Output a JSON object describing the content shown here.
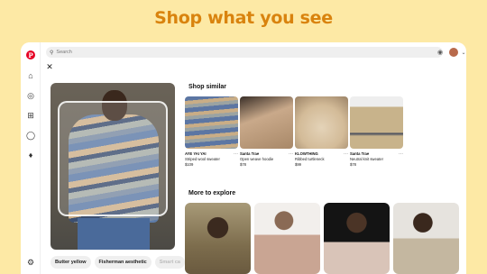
{
  "headline": "Shop what you see",
  "search": {
    "placeholder": "Search"
  },
  "main_chips": [
    "Butter yellow",
    "Fisherman aesthetic",
    "Smart ca"
  ],
  "shop_similar": {
    "title": "Shop similar",
    "items": [
      {
        "brand": "AYE YAI YAI",
        "name": "Striped wool sweater",
        "price": "$109",
        "color": "#8a9bb4"
      },
      {
        "brand": "Santa Trae",
        "name": "Open weave hoodie",
        "price": "$78",
        "color": "#c9a98a"
      },
      {
        "brand": "KLOWTHING",
        "name": "Ribbed turtleneck",
        "price": "$99",
        "color": "#d8c2a2"
      },
      {
        "brand": "Santa Trae",
        "name": "Neutral knit sweater",
        "price": "$78",
        "color": "#c8b38b"
      }
    ]
  },
  "more_to_explore": {
    "title": "More to explore",
    "tiles": [
      "#8a7a5a",
      "#c7b3a5",
      "#1f1d1c",
      "#d7d3cc"
    ]
  },
  "icons": {
    "logo": "pinterest-logo",
    "home": "home-icon",
    "explore": "compass-icon",
    "create": "plus-square-icon",
    "messages": "chat-icon",
    "notifications": "bell-icon",
    "settings": "gear-icon"
  },
  "colors": {
    "background": "#fde9a5",
    "accent": "#d9830e",
    "brand": "#e60023"
  }
}
